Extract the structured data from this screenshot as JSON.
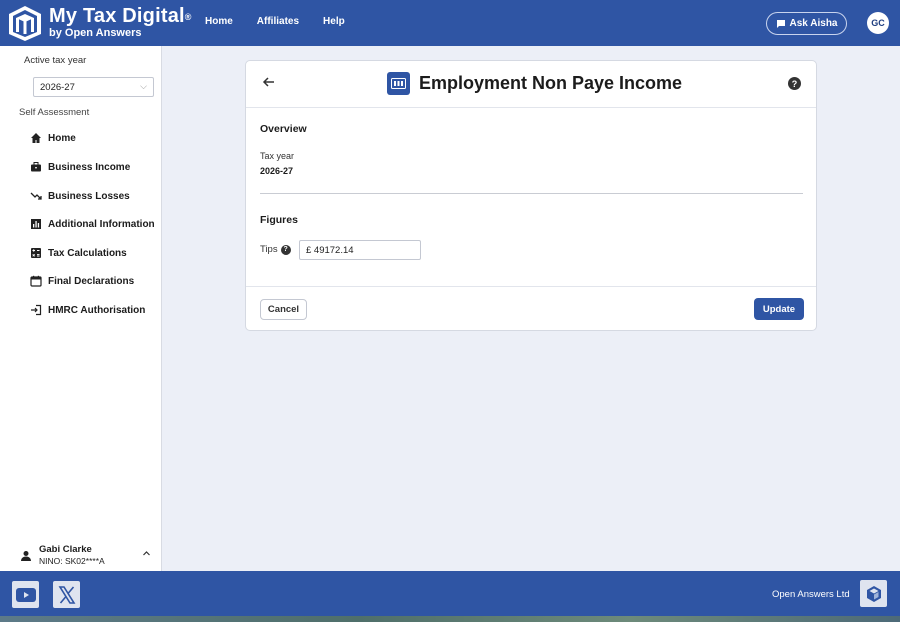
{
  "header": {
    "brand_title": "My Tax Digital",
    "brand_mark": "®",
    "brand_subtitle": "by Open Answers",
    "nav": [
      "Home",
      "Affiliates",
      "Help"
    ],
    "ask_label": "Ask Aisha",
    "avatar_initials": "GC",
    "accent_color": "#2f55a4"
  },
  "sidebar": {
    "tax_year_label": "Active tax year",
    "tax_year_value": "2026-27",
    "section_label": "Self Assessment",
    "items": [
      {
        "label": "Home",
        "icon": "home-icon"
      },
      {
        "label": "Business Income",
        "icon": "briefcase-icon"
      },
      {
        "label": "Business Losses",
        "icon": "trending-down-icon"
      },
      {
        "label": "Additional Information",
        "icon": "bar-chart-icon"
      },
      {
        "label": "Tax Calculations",
        "icon": "calculator-icon"
      },
      {
        "label": "Final Declarations",
        "icon": "calendar-icon"
      },
      {
        "label": "HMRC Authorisation",
        "icon": "login-icon"
      }
    ],
    "user": {
      "name": "Gabi Clarke",
      "nino": "NINO: SK02****A"
    }
  },
  "card": {
    "title": "Employment Non Paye Income",
    "overview_heading": "Overview",
    "tax_year_label": "Tax year",
    "tax_year_value": "2026-27",
    "figures_heading": "Figures",
    "tips_label": "Tips",
    "tips_value": "£ 49172.14",
    "cancel_label": "Cancel",
    "update_label": "Update"
  },
  "footer": {
    "company": "Open Answers Ltd"
  }
}
